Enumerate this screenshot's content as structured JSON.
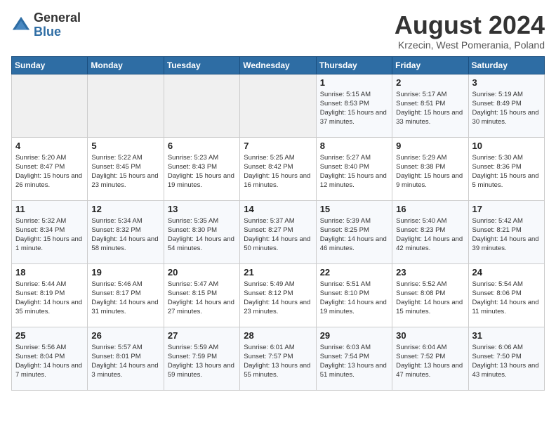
{
  "header": {
    "logo_general": "General",
    "logo_blue": "Blue",
    "month_year": "August 2024",
    "location": "Krzecin, West Pomerania, Poland"
  },
  "weekdays": [
    "Sunday",
    "Monday",
    "Tuesday",
    "Wednesday",
    "Thursday",
    "Friday",
    "Saturday"
  ],
  "weeks": [
    [
      {
        "day": "",
        "sunrise": "",
        "sunset": "",
        "daylight": ""
      },
      {
        "day": "",
        "sunrise": "",
        "sunset": "",
        "daylight": ""
      },
      {
        "day": "",
        "sunrise": "",
        "sunset": "",
        "daylight": ""
      },
      {
        "day": "",
        "sunrise": "",
        "sunset": "",
        "daylight": ""
      },
      {
        "day": "1",
        "sunrise": "Sunrise: 5:15 AM",
        "sunset": "Sunset: 8:53 PM",
        "daylight": "Daylight: 15 hours and 37 minutes."
      },
      {
        "day": "2",
        "sunrise": "Sunrise: 5:17 AM",
        "sunset": "Sunset: 8:51 PM",
        "daylight": "Daylight: 15 hours and 33 minutes."
      },
      {
        "day": "3",
        "sunrise": "Sunrise: 5:19 AM",
        "sunset": "Sunset: 8:49 PM",
        "daylight": "Daylight: 15 hours and 30 minutes."
      }
    ],
    [
      {
        "day": "4",
        "sunrise": "Sunrise: 5:20 AM",
        "sunset": "Sunset: 8:47 PM",
        "daylight": "Daylight: 15 hours and 26 minutes."
      },
      {
        "day": "5",
        "sunrise": "Sunrise: 5:22 AM",
        "sunset": "Sunset: 8:45 PM",
        "daylight": "Daylight: 15 hours and 23 minutes."
      },
      {
        "day": "6",
        "sunrise": "Sunrise: 5:23 AM",
        "sunset": "Sunset: 8:43 PM",
        "daylight": "Daylight: 15 hours and 19 minutes."
      },
      {
        "day": "7",
        "sunrise": "Sunrise: 5:25 AM",
        "sunset": "Sunset: 8:42 PM",
        "daylight": "Daylight: 15 hours and 16 minutes."
      },
      {
        "day": "8",
        "sunrise": "Sunrise: 5:27 AM",
        "sunset": "Sunset: 8:40 PM",
        "daylight": "Daylight: 15 hours and 12 minutes."
      },
      {
        "day": "9",
        "sunrise": "Sunrise: 5:29 AM",
        "sunset": "Sunset: 8:38 PM",
        "daylight": "Daylight: 15 hours and 9 minutes."
      },
      {
        "day": "10",
        "sunrise": "Sunrise: 5:30 AM",
        "sunset": "Sunset: 8:36 PM",
        "daylight": "Daylight: 15 hours and 5 minutes."
      }
    ],
    [
      {
        "day": "11",
        "sunrise": "Sunrise: 5:32 AM",
        "sunset": "Sunset: 8:34 PM",
        "daylight": "Daylight: 15 hours and 1 minute."
      },
      {
        "day": "12",
        "sunrise": "Sunrise: 5:34 AM",
        "sunset": "Sunset: 8:32 PM",
        "daylight": "Daylight: 14 hours and 58 minutes."
      },
      {
        "day": "13",
        "sunrise": "Sunrise: 5:35 AM",
        "sunset": "Sunset: 8:30 PM",
        "daylight": "Daylight: 14 hours and 54 minutes."
      },
      {
        "day": "14",
        "sunrise": "Sunrise: 5:37 AM",
        "sunset": "Sunset: 8:27 PM",
        "daylight": "Daylight: 14 hours and 50 minutes."
      },
      {
        "day": "15",
        "sunrise": "Sunrise: 5:39 AM",
        "sunset": "Sunset: 8:25 PM",
        "daylight": "Daylight: 14 hours and 46 minutes."
      },
      {
        "day": "16",
        "sunrise": "Sunrise: 5:40 AM",
        "sunset": "Sunset: 8:23 PM",
        "daylight": "Daylight: 14 hours and 42 minutes."
      },
      {
        "day": "17",
        "sunrise": "Sunrise: 5:42 AM",
        "sunset": "Sunset: 8:21 PM",
        "daylight": "Daylight: 14 hours and 39 minutes."
      }
    ],
    [
      {
        "day": "18",
        "sunrise": "Sunrise: 5:44 AM",
        "sunset": "Sunset: 8:19 PM",
        "daylight": "Daylight: 14 hours and 35 minutes."
      },
      {
        "day": "19",
        "sunrise": "Sunrise: 5:46 AM",
        "sunset": "Sunset: 8:17 PM",
        "daylight": "Daylight: 14 hours and 31 minutes."
      },
      {
        "day": "20",
        "sunrise": "Sunrise: 5:47 AM",
        "sunset": "Sunset: 8:15 PM",
        "daylight": "Daylight: 14 hours and 27 minutes."
      },
      {
        "day": "21",
        "sunrise": "Sunrise: 5:49 AM",
        "sunset": "Sunset: 8:12 PM",
        "daylight": "Daylight: 14 hours and 23 minutes."
      },
      {
        "day": "22",
        "sunrise": "Sunrise: 5:51 AM",
        "sunset": "Sunset: 8:10 PM",
        "daylight": "Daylight: 14 hours and 19 minutes."
      },
      {
        "day": "23",
        "sunrise": "Sunrise: 5:52 AM",
        "sunset": "Sunset: 8:08 PM",
        "daylight": "Daylight: 14 hours and 15 minutes."
      },
      {
        "day": "24",
        "sunrise": "Sunrise: 5:54 AM",
        "sunset": "Sunset: 8:06 PM",
        "daylight": "Daylight: 14 hours and 11 minutes."
      }
    ],
    [
      {
        "day": "25",
        "sunrise": "Sunrise: 5:56 AM",
        "sunset": "Sunset: 8:04 PM",
        "daylight": "Daylight: 14 hours and 7 minutes."
      },
      {
        "day": "26",
        "sunrise": "Sunrise: 5:57 AM",
        "sunset": "Sunset: 8:01 PM",
        "daylight": "Daylight: 14 hours and 3 minutes."
      },
      {
        "day": "27",
        "sunrise": "Sunrise: 5:59 AM",
        "sunset": "Sunset: 7:59 PM",
        "daylight": "Daylight: 13 hours and 59 minutes."
      },
      {
        "day": "28",
        "sunrise": "Sunrise: 6:01 AM",
        "sunset": "Sunset: 7:57 PM",
        "daylight": "Daylight: 13 hours and 55 minutes."
      },
      {
        "day": "29",
        "sunrise": "Sunrise: 6:03 AM",
        "sunset": "Sunset: 7:54 PM",
        "daylight": "Daylight: 13 hours and 51 minutes."
      },
      {
        "day": "30",
        "sunrise": "Sunrise: 6:04 AM",
        "sunset": "Sunset: 7:52 PM",
        "daylight": "Daylight: 13 hours and 47 minutes."
      },
      {
        "day": "31",
        "sunrise": "Sunrise: 6:06 AM",
        "sunset": "Sunset: 7:50 PM",
        "daylight": "Daylight: 13 hours and 43 minutes."
      }
    ]
  ]
}
